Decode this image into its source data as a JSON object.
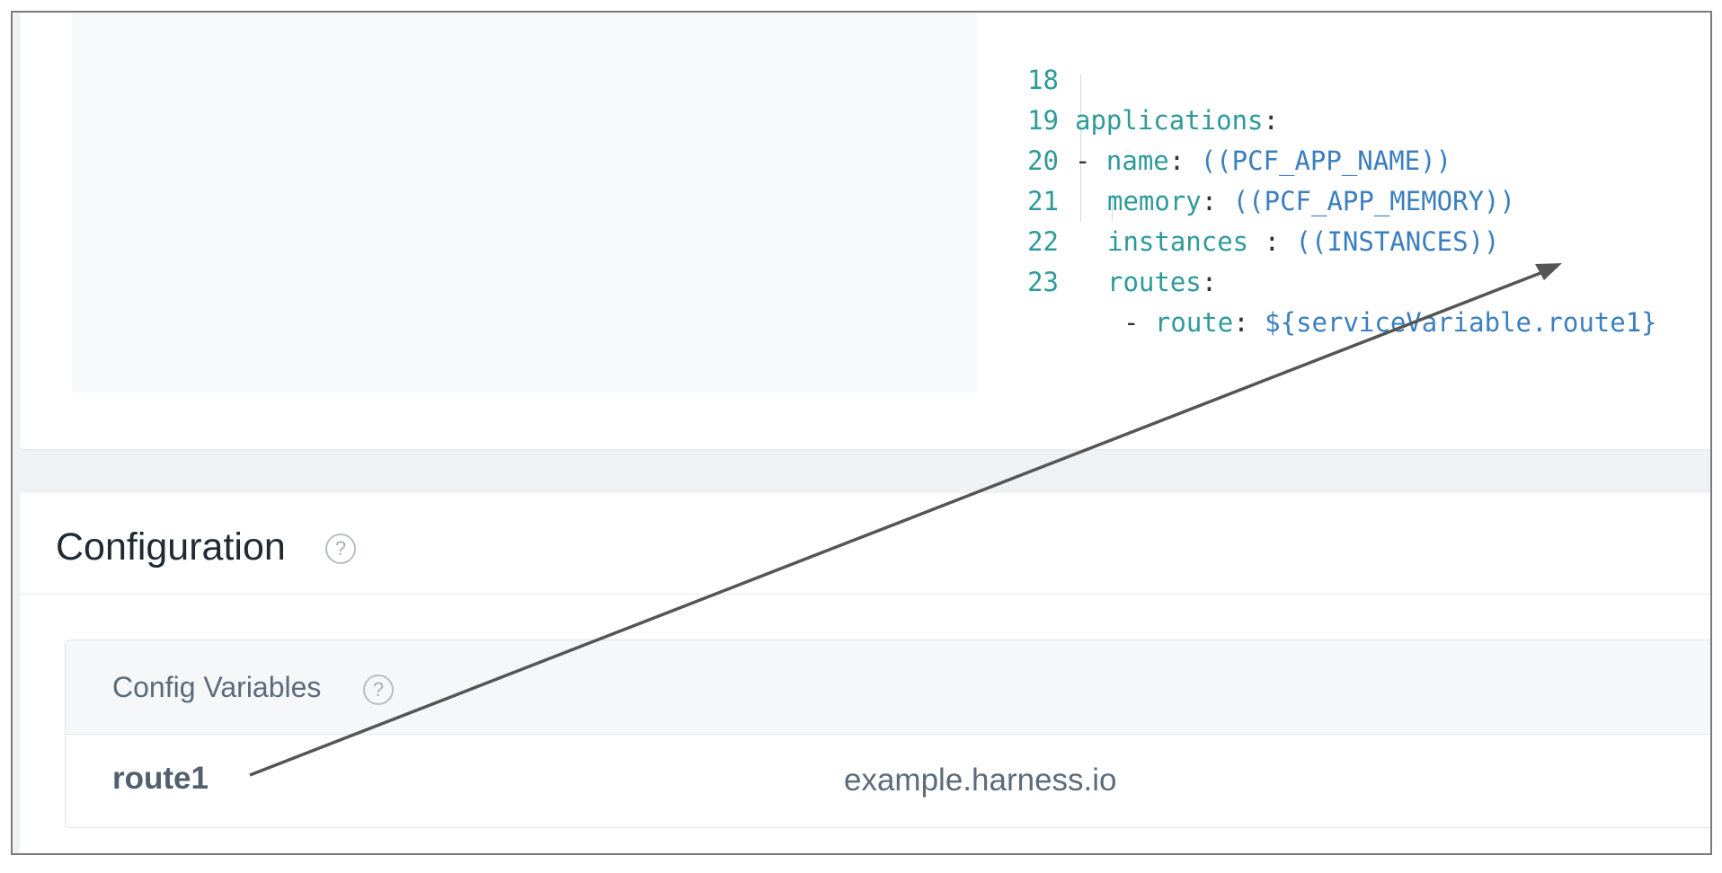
{
  "editor": {
    "lines": [
      {
        "no": "18",
        "key": "applications",
        "sep": ":",
        "value": "",
        "dash": ""
      },
      {
        "no": "19",
        "key": "name",
        "sep": ": ",
        "value": "((PCF_APP_NAME))",
        "dash": "- "
      },
      {
        "no": "20",
        "key": "memory",
        "sep": ": ",
        "value": "((PCF_APP_MEMORY))",
        "dash": ""
      },
      {
        "no": "21",
        "key": "instances",
        "sep": " : ",
        "value": "((INSTANCES))",
        "dash": ""
      },
      {
        "no": "22",
        "key": "routes",
        "sep": ":",
        "value": "",
        "dash": ""
      },
      {
        "no": "23",
        "key": "route",
        "sep": ": ",
        "value": "${serviceVariable.route1}",
        "dash": "- "
      }
    ]
  },
  "configuration": {
    "title": "Configuration",
    "help": "?"
  },
  "config_variables": {
    "header": "Config Variables",
    "help": "?",
    "rows": [
      {
        "name": "route1",
        "value": "example.harness.io"
      }
    ]
  },
  "colors": {
    "key": "#2f9a9a",
    "value": "#3b7fbf",
    "arrow": "#555555"
  }
}
